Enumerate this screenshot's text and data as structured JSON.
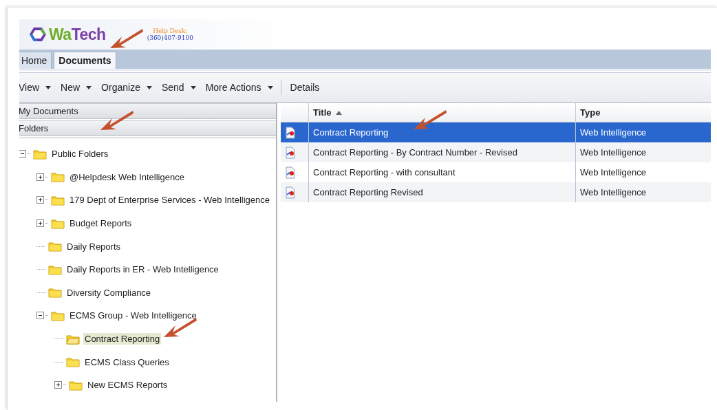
{
  "header": {
    "logo": {
      "name_1": "Wa",
      "name_2": "Tech"
    },
    "help_desk": {
      "label": "Help Desk:",
      "phone": "(360)407-9100"
    }
  },
  "tabs": [
    {
      "label": "Home",
      "selected": false,
      "arrow": false
    },
    {
      "label": "Documents",
      "selected": true,
      "arrow": true
    }
  ],
  "toolbar": [
    {
      "label": "View",
      "dropdown": true
    },
    {
      "label": "New",
      "dropdown": true
    },
    {
      "label": "Organize",
      "dropdown": true
    },
    {
      "label": "Send",
      "dropdown": true
    },
    {
      "label": "More Actions",
      "dropdown": true
    },
    {
      "label": "Details",
      "dropdown": false
    }
  ],
  "sidebar": {
    "sections": [
      {
        "label": "My Documents",
        "arrow": false
      },
      {
        "label": "Folders",
        "arrow": true
      }
    ],
    "tree": [
      {
        "label": "Public Folders",
        "kind": "branch",
        "expanded": true,
        "selected": false,
        "arrow": false,
        "children": [
          {
            "label": "@Helpdesk Web Intelligence",
            "kind": "branch",
            "expanded": false,
            "selected": false,
            "arrow": false
          },
          {
            "label": "179 Dept of Enterprise Services - Web Intelligence",
            "kind": "branch",
            "expanded": false,
            "selected": false,
            "arrow": false
          },
          {
            "label": "Budget Reports",
            "kind": "branch",
            "expanded": false,
            "selected": false,
            "arrow": false
          },
          {
            "label": "Daily Reports",
            "kind": "leaf",
            "selected": false,
            "arrow": false
          },
          {
            "label": "Daily Reports in ER - Web Intelligence",
            "kind": "leaf",
            "selected": false,
            "arrow": false
          },
          {
            "label": "Diversity Compliance",
            "kind": "leaf",
            "selected": false,
            "arrow": false
          },
          {
            "label": "ECMS Group - Web Intelligence",
            "kind": "branch",
            "expanded": true,
            "selected": false,
            "arrow": false,
            "children": [
              {
                "label": "Contract Reporting",
                "kind": "leaf",
                "selected": true,
                "arrow": true
              },
              {
                "label": "ECMS Class Queries",
                "kind": "leaf",
                "selected": false,
                "arrow": false
              },
              {
                "label": "New ECMS Reports",
                "kind": "branch",
                "expanded": false,
                "selected": false,
                "arrow": false
              }
            ]
          }
        ]
      }
    ]
  },
  "table": {
    "columns": [
      {
        "label": "Title",
        "sorted": true
      },
      {
        "label": "Type",
        "sorted": false
      }
    ],
    "rows": [
      {
        "title": "Contract Reporting",
        "type": "Web Intelligence",
        "selected": true,
        "arrow": true
      },
      {
        "title": "Contract Reporting - By Contract Number - Revised",
        "type": "Web Intelligence",
        "selected": false,
        "arrow": false
      },
      {
        "title": "Contract Reporting - with consultant",
        "type": "Web Intelligence",
        "selected": false,
        "arrow": false
      },
      {
        "title": "Contract Reporting Revised",
        "type": "Web Intelligence",
        "selected": false,
        "arrow": false
      }
    ]
  }
}
